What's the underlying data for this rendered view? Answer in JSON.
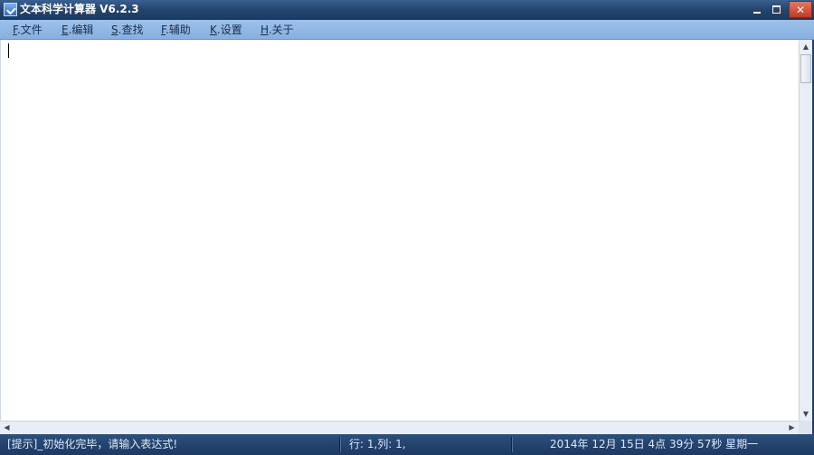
{
  "window": {
    "title": "文本科学计算器 V6.2.3",
    "accent_color": "#24466f",
    "menu_color": "#8fb7e4",
    "close_color": "#c94a32"
  },
  "menu": [
    {
      "key": "F",
      "label": ".文件"
    },
    {
      "key": "E",
      "label": ".编辑"
    },
    {
      "key": "S",
      "label": ".查找"
    },
    {
      "key": "F",
      "label": ".辅助"
    },
    {
      "key": "K",
      "label": ".设置"
    },
    {
      "key": "H",
      "label": ".关于"
    }
  ],
  "editor": {
    "content": ""
  },
  "status": {
    "hint": "[提示]_初始化完毕，请输入表达式!",
    "position": "行: 1,列: 1,",
    "datetime": "2014年 12月 15日  4点 39分 57秒   星期一"
  }
}
